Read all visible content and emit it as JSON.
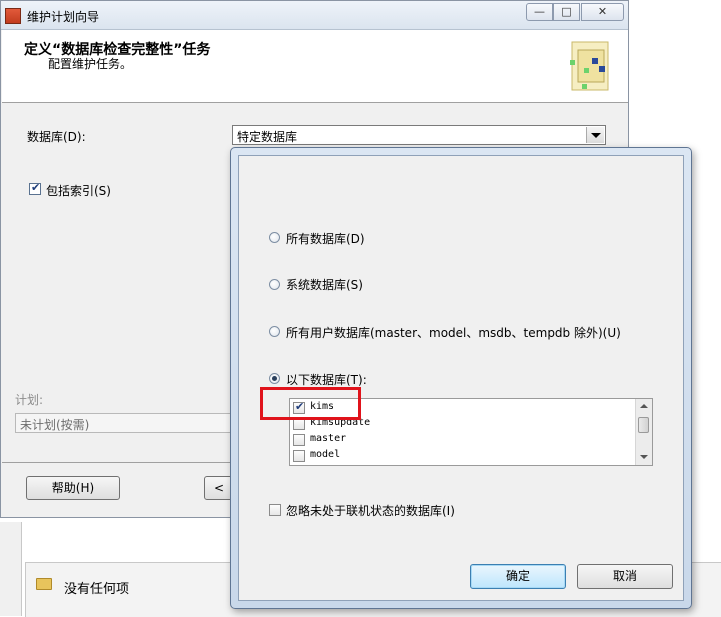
{
  "window": {
    "title": "维护计划向导",
    "buttons": {
      "min": "—",
      "max": "□",
      "close": "✕"
    }
  },
  "header": {
    "title": "定义“数据库检查完整性”任务",
    "subtitle": "配置维护任务。"
  },
  "form": {
    "database_label": "数据库(D):",
    "database_value": "特定数据库",
    "include_indexes_label": "包括索引(S)",
    "include_indexes_checked": true,
    "schedule_label": "计划:",
    "schedule_value": "未计划(按需)"
  },
  "footer": {
    "help_label": "帮助(H)",
    "back_label": "<"
  },
  "popup": {
    "options": [
      {
        "label": "所有数据库(D)",
        "selected": false
      },
      {
        "label": "系统数据库(S)",
        "selected": false
      },
      {
        "label": "所有用户数据库(master、model、msdb、tempdb 除外)(U)",
        "selected": false
      },
      {
        "label": "以下数据库(T):",
        "selected": true
      }
    ],
    "databases": [
      {
        "name": "kims",
        "checked": true
      },
      {
        "name": "kimsupdate",
        "checked": false
      },
      {
        "name": "master",
        "checked": false
      },
      {
        "name": "model",
        "checked": false
      }
    ],
    "ignore_offline_label": "忽略未处于联机状态的数据库(I)",
    "ok_label": "确定",
    "cancel_label": "取消"
  },
  "background": {
    "empty_label": "没有任何项"
  },
  "colors": {
    "highlight": "#e0131b",
    "ok_button": "#bee6fd"
  }
}
